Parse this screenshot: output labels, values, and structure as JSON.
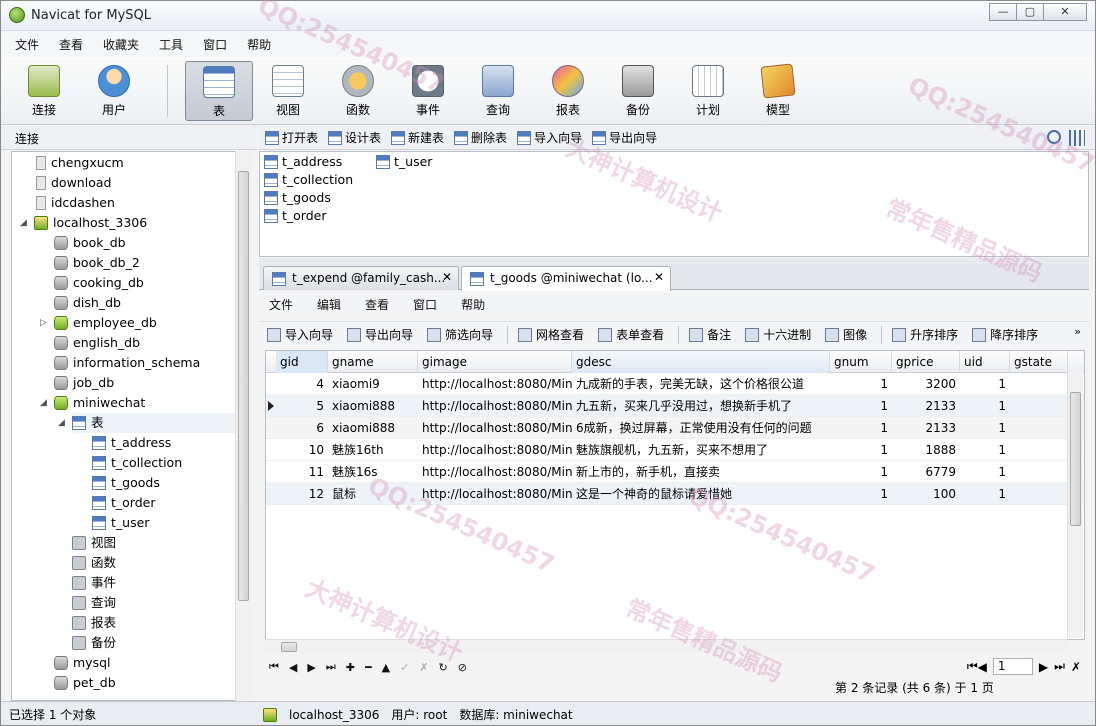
{
  "window": {
    "title": "Navicat for MySQL",
    "btn_min": "—",
    "btn_max": "▢",
    "btn_close": "✕"
  },
  "menubar": [
    "文件",
    "查看",
    "收藏夹",
    "工具",
    "窗口",
    "帮助"
  ],
  "toolbar": [
    {
      "label": "连接",
      "icon": "connect-icon"
    },
    {
      "label": "用户",
      "icon": "user-icon"
    },
    {
      "label": "表",
      "icon": "table-icon",
      "active": true
    },
    {
      "label": "视图",
      "icon": "view-icon"
    },
    {
      "label": "函数",
      "icon": "function-icon"
    },
    {
      "label": "事件",
      "icon": "event-icon"
    },
    {
      "label": "查询",
      "icon": "query-icon"
    },
    {
      "label": "报表",
      "icon": "report-icon"
    },
    {
      "label": "备份",
      "icon": "backup-icon"
    },
    {
      "label": "计划",
      "icon": "schedule-icon"
    },
    {
      "label": "模型",
      "icon": "model-icon"
    }
  ],
  "left_panel": {
    "header": "连接",
    "tree": [
      {
        "label": "chengxucm",
        "icon": "conn-gray"
      },
      {
        "label": "download",
        "icon": "conn-gray"
      },
      {
        "label": "idcdashen",
        "icon": "conn-gray"
      },
      {
        "label": "localhost_3306",
        "icon": "host",
        "toggle": "◢"
      },
      {
        "label": "book_db",
        "icon": "db-gray"
      },
      {
        "label": "book_db_2",
        "icon": "db-gray"
      },
      {
        "label": "cooking_db",
        "icon": "db-gray"
      },
      {
        "label": "dish_db",
        "icon": "db-gray"
      },
      {
        "label": "employee_db",
        "icon": "db-green",
        "toggle": "▷"
      },
      {
        "label": "english_db",
        "icon": "db-gray"
      },
      {
        "label": "information_schema",
        "icon": "db-gray"
      },
      {
        "label": "job_db",
        "icon": "db-gray"
      },
      {
        "label": "miniwechat",
        "icon": "db-green",
        "toggle": "◢"
      },
      {
        "label": "表",
        "icon": "tbl",
        "toggle": "◢"
      },
      {
        "label": "t_address",
        "icon": "tbl"
      },
      {
        "label": "t_collection",
        "icon": "tbl"
      },
      {
        "label": "t_goods",
        "icon": "tbl"
      },
      {
        "label": "t_order",
        "icon": "tbl"
      },
      {
        "label": "t_user",
        "icon": "tbl"
      },
      {
        "label": "视图",
        "icon": "misc"
      },
      {
        "label": "函数",
        "icon": "misc"
      },
      {
        "label": "事件",
        "icon": "misc"
      },
      {
        "label": "查询",
        "icon": "misc"
      },
      {
        "label": "报表",
        "icon": "misc"
      },
      {
        "label": "备份",
        "icon": "misc"
      },
      {
        "label": "mysql",
        "icon": "db-gray"
      },
      {
        "label": "pet_db",
        "icon": "db-gray"
      }
    ]
  },
  "object_toolbar": [
    "打开表",
    "设计表",
    "新建表",
    "删除表",
    "导入向导",
    "导出向导"
  ],
  "objects": [
    "t_address",
    "t_collection",
    "t_goods",
    "t_order",
    "t_user"
  ],
  "tabs": [
    {
      "label": "t_expend @family_cash...",
      "close": "✕"
    },
    {
      "label": "t_goods @miniwechat (lo...",
      "close": "✕",
      "active": true
    }
  ],
  "inner_menubar": [
    "文件",
    "编辑",
    "查看",
    "窗口",
    "帮助"
  ],
  "data_toolbar": [
    "导入向导",
    "导出向导",
    "筛选向导",
    "网格查看",
    "表单查看",
    "备注",
    "十六进制",
    "图像",
    "升序排序",
    "降序排序"
  ],
  "data_toolbar_more": "»",
  "grid": {
    "columns": [
      "gid",
      "gname",
      "gimage",
      "gdesc",
      "gnum",
      "gprice",
      "uid",
      "gstate"
    ],
    "rows": [
      [
        "4",
        "xiaomi9",
        "http://localhost:8080/Mini",
        "九成新的手表，完美无缺，这个价格很公道",
        "1",
        "3200",
        "1",
        ""
      ],
      [
        "5",
        "xiaomi888",
        "http://localhost:8080/Mini",
        "九五新，买来几乎没用过，想换新手机了",
        "1",
        "2133",
        "1",
        ""
      ],
      [
        "6",
        "xiaomi888",
        "http://localhost:8080/Mini",
        "6成新，换过屏幕，正常使用没有任何的问题",
        "1",
        "2133",
        "1",
        ""
      ],
      [
        "10",
        "魅族16th",
        "http://localhost:8080/Mini",
        "魅族旗舰机，九五新，买来不想用了",
        "1",
        "1888",
        "1",
        ""
      ],
      [
        "11",
        "魅族16s",
        "http://localhost:8080/Mini",
        "新上市的，新手机，直接卖",
        "1",
        "6779",
        "1",
        ""
      ],
      [
        "12",
        "鼠标",
        "http://localhost:8080/Mini",
        "这是一个神奇的鼠标请爱惜她",
        "1",
        "100",
        "1",
        ""
      ]
    ]
  },
  "nav": {
    "buttons": [
      "⏮",
      "◀",
      "▶",
      "⏭",
      "✚",
      "━",
      "▲",
      "✓",
      "✗",
      "↻",
      "⊘"
    ],
    "page": "1",
    "record_info": "第 2 条记录 (共 6 条) 于 1 页"
  },
  "status": {
    "left": "已选择 1 个对象",
    "connection": "localhost_3306",
    "user": "用户: root",
    "database": "数据库: miniwechat"
  },
  "watermarks": [
    "QQ:254540457",
    "大神计算机设计",
    "常年售精品源码"
  ]
}
